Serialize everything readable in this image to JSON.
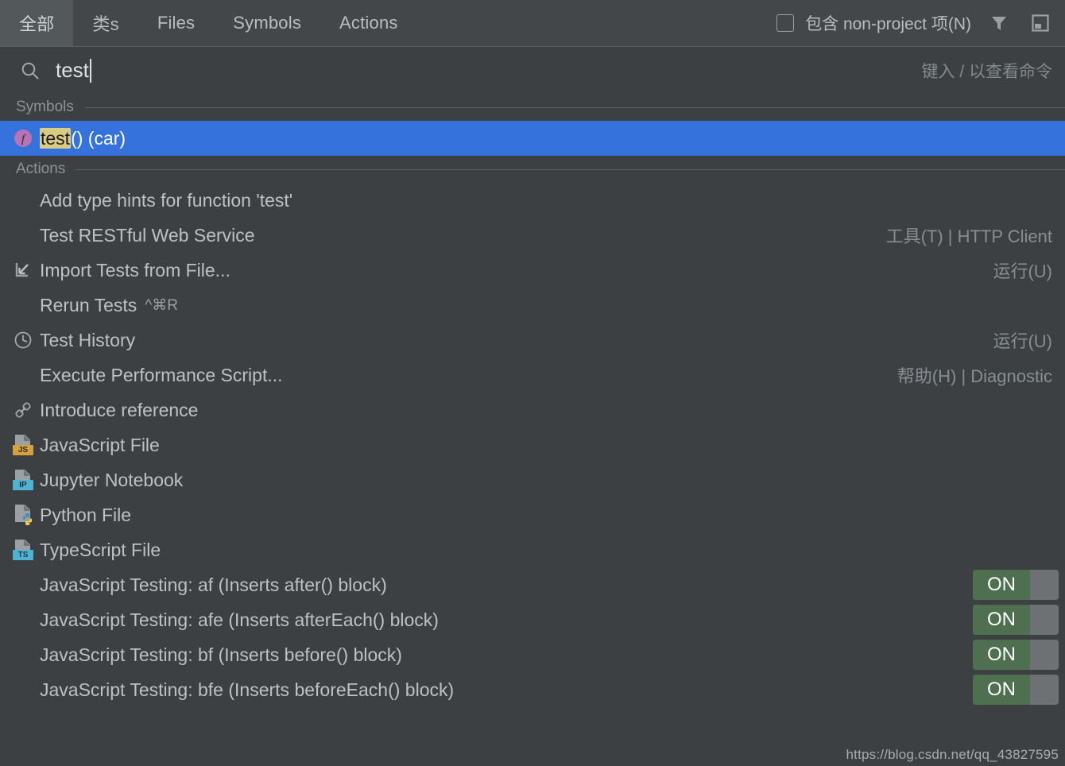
{
  "header": {
    "tabs": [
      {
        "label": "全部",
        "active": true,
        "name": "tab-all"
      },
      {
        "label": "类s",
        "active": false,
        "name": "tab-classes"
      },
      {
        "label": "Files",
        "active": false,
        "name": "tab-files"
      },
      {
        "label": "Symbols",
        "active": false,
        "name": "tab-symbols"
      },
      {
        "label": "Actions",
        "active": false,
        "name": "tab-actions"
      }
    ],
    "checkbox_label": "包含 non-project 项(N)",
    "checkbox_checked": false,
    "filter_icon": "filter-icon",
    "window_icon": "window-preview-icon"
  },
  "search": {
    "icon": "search-icon",
    "value": "test",
    "placeholder": "",
    "hint": "键入 / 以查看命令"
  },
  "groups": [
    {
      "title": "Symbols",
      "name": "group-symbols",
      "rows": [
        {
          "icon": "function-icon",
          "selected": true,
          "highlight": "test",
          "rest": "() (car)",
          "right": "",
          "shortcut": "",
          "toggle": null
        }
      ]
    },
    {
      "title": "Actions",
      "name": "group-actions",
      "rows": [
        {
          "icon": "",
          "label": "Add type hints for function 'test'",
          "right": "",
          "shortcut": "",
          "toggle": null
        },
        {
          "icon": "",
          "label": "Test RESTful Web Service",
          "right": "工具(T) | HTTP Client",
          "shortcut": "",
          "toggle": null
        },
        {
          "icon": "import-icon",
          "label": "Import Tests from File...",
          "right": "运行(U)",
          "shortcut": "",
          "toggle": null
        },
        {
          "icon": "",
          "label": "Rerun Tests",
          "right": "",
          "shortcut": "^⌘R",
          "toggle": null
        },
        {
          "icon": "clock-icon",
          "label": "Test History",
          "right": "运行(U)",
          "shortcut": "",
          "toggle": null
        },
        {
          "icon": "",
          "label": "Execute Performance Script...",
          "right": "帮助(H) | Diagnostic",
          "shortcut": "",
          "toggle": null
        },
        {
          "icon": "link-icon",
          "label": "Introduce reference",
          "right": "",
          "shortcut": "",
          "toggle": null
        },
        {
          "icon": "js-file-icon",
          "label": "JavaScript File",
          "right": "",
          "shortcut": "",
          "toggle": null
        },
        {
          "icon": "ipynb-file-icon",
          "label": "Jupyter Notebook",
          "right": "",
          "shortcut": "",
          "toggle": null
        },
        {
          "icon": "python-file-icon",
          "label": "Python File",
          "right": "",
          "shortcut": "",
          "toggle": null
        },
        {
          "icon": "ts-file-icon",
          "label": "TypeScript File",
          "right": "",
          "shortcut": "",
          "toggle": null
        },
        {
          "icon": "",
          "label": "JavaScript Testing: af (Inserts after() block)",
          "right": "",
          "shortcut": "",
          "toggle": "ON"
        },
        {
          "icon": "",
          "label": "JavaScript Testing: afe (Inserts afterEach() block)",
          "right": "",
          "shortcut": "",
          "toggle": "ON"
        },
        {
          "icon": "",
          "label": "JavaScript Testing: bf (Inserts before() block)",
          "right": "",
          "shortcut": "",
          "toggle": "ON"
        },
        {
          "icon": "",
          "label": "JavaScript Testing: bfe (Inserts beforeEach() block)",
          "right": "",
          "shortcut": "",
          "toggle": "ON"
        }
      ]
    }
  ],
  "toggle_on_label": "ON",
  "watermark": "https://blog.csdn.net/qq_43827595",
  "colors": {
    "background": "#3c4042",
    "header": "#434749",
    "active_tab": "#53585a",
    "selection": "#3672dc",
    "highlight": "#d9cb83",
    "toggle_on": "#4e7050",
    "text": "#bdc1c2",
    "muted": "#878d90"
  }
}
